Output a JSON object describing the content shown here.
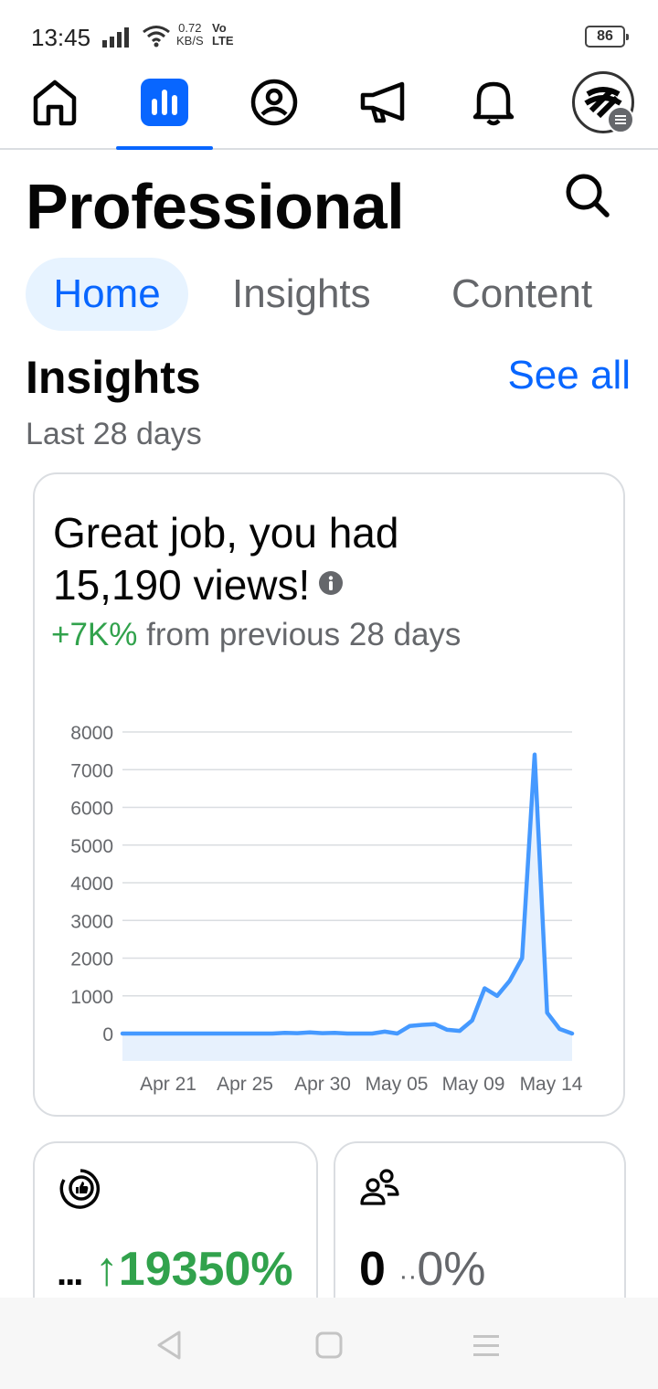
{
  "status_bar": {
    "time": "13:45",
    "net_speed_value": "0.72",
    "net_speed_unit": "KB/S",
    "volte_top": "Vo",
    "volte_bottom": "LTE",
    "battery": "86"
  },
  "top_nav": {
    "items": [
      "home-icon",
      "dashboard-icon",
      "profile-icon",
      "megaphone-icon",
      "bell-icon",
      "avatar"
    ],
    "active": "dashboard-icon",
    "accent": "#0866ff"
  },
  "header": {
    "title": "Professional"
  },
  "tabs": [
    {
      "label": "Home",
      "selected": true
    },
    {
      "label": "Insights",
      "selected": false
    },
    {
      "label": "Content",
      "selected": false
    }
  ],
  "insights": {
    "title": "Insights",
    "see_all": "See all",
    "period": "Last 28 days",
    "headline_line1": "Great job, you had",
    "headline_line2": "15,190 views!",
    "change_value": "+7K%",
    "change_text": "from previous 28 days",
    "positive_color": "#31a24c"
  },
  "chart_data": {
    "type": "area",
    "x_tick_labels": [
      "Apr 21",
      "Apr 25",
      "Apr 30",
      "May 05",
      "May 09",
      "May 14"
    ],
    "y_tick_labels": [
      "8000",
      "7000",
      "6000",
      "5000",
      "4000",
      "3000",
      "2000",
      "1000",
      "0"
    ],
    "ylim": [
      0,
      8000
    ],
    "grid": true,
    "series_color": "#4599ff",
    "fill_color": "#e7f1fd",
    "values": [
      0,
      0,
      0,
      0,
      0,
      0,
      0,
      0,
      0,
      0,
      0,
      0,
      0,
      20,
      10,
      30,
      10,
      20,
      0,
      0,
      0,
      50,
      0,
      200,
      230,
      250,
      100,
      70,
      350,
      1200,
      1000,
      1400,
      2000,
      7400,
      550,
      120,
      0
    ]
  },
  "small_cards": {
    "left": {
      "icon": "like-icon",
      "prefix": "...",
      "arrow": "↑",
      "value": "19350%"
    },
    "right": {
      "icon": "people-icon",
      "value": "0",
      "separator": "··",
      "pct": "0%"
    }
  },
  "system_nav": {
    "items": [
      "back-icon",
      "home-square-icon",
      "menu-icon"
    ]
  }
}
